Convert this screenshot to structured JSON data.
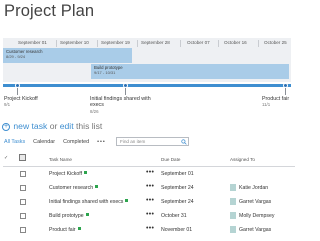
{
  "page": {
    "title": "Project Plan"
  },
  "timeline": {
    "dates": [
      "September 01",
      "September 10",
      "September 19",
      "September 28",
      "October 07",
      "October 16",
      "October 25"
    ],
    "bars": [
      {
        "name": "Customer research",
        "dates": "8/29 - 9/24"
      },
      {
        "name": "Build prototype",
        "dates": "9/17 - 10/31"
      }
    ],
    "milestones": [
      {
        "name": "Project Kickoff",
        "date": "9/1"
      },
      {
        "name": "Initial findings shared with execs",
        "date": "8/26"
      },
      {
        "name": "Product fair",
        "date": "11/1"
      }
    ]
  },
  "newtask": {
    "prefix": "new task",
    "or": "or",
    "edit": "edit",
    "suffix": "this list"
  },
  "views": {
    "tabs": [
      "All Tasks",
      "Calendar",
      "Completed"
    ],
    "more": "•••",
    "search_placeholder": "Find an item"
  },
  "table": {
    "headers": {
      "check": "✓",
      "task": "Task Name",
      "due": "Due Date",
      "assigned": "Assigned To"
    },
    "rows": [
      {
        "name": "Project Kickoff",
        "date": "September 01",
        "person": ""
      },
      {
        "name": "Customer research",
        "date": "September 24",
        "person": "Katie Jordan"
      },
      {
        "name": "Initial findings shared with execs",
        "date": "September 24",
        "person": "Garret Vargas"
      },
      {
        "name": "Build prototype",
        "date": "October 31",
        "person": "Molly Dempsey"
      },
      {
        "name": "Product fair",
        "date": "November 01",
        "person": "Garret Vargas"
      }
    ],
    "more": "•••"
  }
}
